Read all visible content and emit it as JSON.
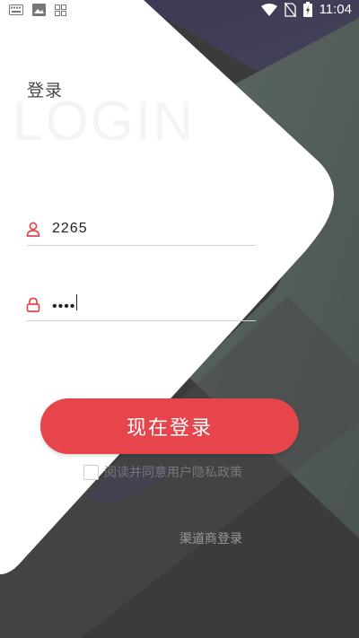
{
  "status_bar": {
    "time": "11:04",
    "left_icons": [
      "keyboard-icon",
      "image-icon",
      "app-grid-icon"
    ],
    "right_icons": [
      "wifi-icon",
      "no-sim-icon",
      "battery-charging-icon"
    ]
  },
  "login": {
    "title": "登录",
    "watermark": "LOGIN",
    "username_value": "2265",
    "password_value": "••••",
    "button_label": "现在登录",
    "agreement_label": "阅读并同意用户隐私政策",
    "channel_login_label": "渠道商登录"
  },
  "colors": {
    "accent": "#e5454b",
    "background_dark": "#3a3a3a",
    "panel": "#ffffff",
    "field_underline": "#cfcfe0"
  }
}
